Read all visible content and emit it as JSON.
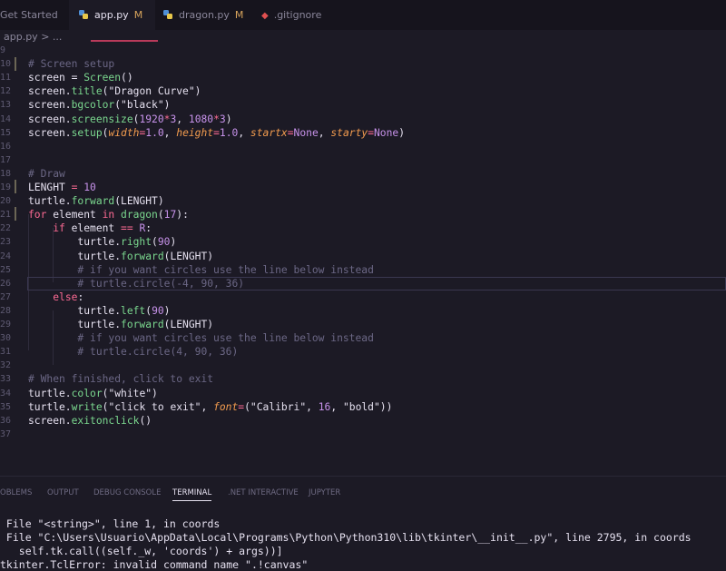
{
  "tabs": [
    {
      "label": "Get Started",
      "modified": "",
      "icon": "none"
    },
    {
      "label": "app.py",
      "modified": "M",
      "icon": "python-icon"
    },
    {
      "label": "dragon.py",
      "modified": "M",
      "icon": "python-icon"
    },
    {
      "label": ".gitignore",
      "modified": "",
      "icon": "git-icon"
    }
  ],
  "breadcrumb": "app.py > ...",
  "editor": {
    "lines": [
      {
        "n": "9",
        "html": ""
      },
      {
        "n": "10",
        "html": "<span class='c-com'># Screen setup</span>"
      },
      {
        "n": "11",
        "html": "screen = <span class='c-fn'>Screen</span>()"
      },
      {
        "n": "12",
        "html": "screen.<span class='c-fn'>title</span>(<span class='c-str'>\"Dragon Curve\"</span>)"
      },
      {
        "n": "13",
        "html": "screen.<span class='c-fn'>bgcolor</span>(<span class='c-str'>\"black\"</span>)"
      },
      {
        "n": "14",
        "html": "screen.<span class='c-fn'>screensize</span>(<span class='c-num'>1920</span><span class='c-op'>*</span><span class='c-num'>3</span>, <span class='c-num'>1080</span><span class='c-op'>*</span><span class='c-num'>3</span>)"
      },
      {
        "n": "15",
        "html": "screen.<span class='c-fn'>setup</span>(<span class='c-param'>width</span><span class='c-op'>=</span><span class='c-num'>1.0</span>, <span class='c-param'>height</span><span class='c-op'>=</span><span class='c-num'>1.0</span>, <span class='c-param'>startx</span><span class='c-op'>=</span><span class='c-const'>None</span>, <span class='c-param'>starty</span><span class='c-op'>=</span><span class='c-const'>None</span>)"
      },
      {
        "n": "16",
        "html": ""
      },
      {
        "n": "17",
        "html": ""
      },
      {
        "n": "18",
        "html": "<span class='c-com'># Draw</span>"
      },
      {
        "n": "19",
        "html": "LENGHT <span class='c-op'>=</span> <span class='c-num'>10</span>"
      },
      {
        "n": "20",
        "html": "turtle.<span class='c-fn'>forward</span>(LENGHT)"
      },
      {
        "n": "21",
        "html": "<span class='c-kw'>for</span> element <span class='c-kw'>in</span> <span class='c-fn'>dragon</span>(<span class='c-num'>17</span>):"
      },
      {
        "n": "22",
        "html": "    <span class='c-kw'>if</span> element <span class='c-op'>==</span> <span class='c-const'>R</span>:"
      },
      {
        "n": "23",
        "html": "        turtle.<span class='c-fn'>right</span>(<span class='c-num'>90</span>)"
      },
      {
        "n": "24",
        "html": "        turtle.<span class='c-fn'>forward</span>(LENGHT)"
      },
      {
        "n": "25",
        "html": "        <span class='c-com'># if you want circles use the line below instead</span>"
      },
      {
        "n": "26",
        "html": "        <span class='c-com'># turtle.circle(-4, 90, 36)</span>"
      },
      {
        "n": "27",
        "html": "    <span class='c-kw'>else</span>:"
      },
      {
        "n": "28",
        "html": "        turtle.<span class='c-fn'>left</span>(<span class='c-num'>90</span>)"
      },
      {
        "n": "29",
        "html": "        turtle.<span class='c-fn'>forward</span>(LENGHT)"
      },
      {
        "n": "30",
        "html": "        <span class='c-com'># if you want circles use the line below instead</span>"
      },
      {
        "n": "31",
        "html": "        <span class='c-com'># turtle.circle(4, 90, 36)</span>"
      },
      {
        "n": "32",
        "html": ""
      },
      {
        "n": "33",
        "html": "<span class='c-com'># When finished, click to exit</span>"
      },
      {
        "n": "34",
        "html": "turtle.<span class='c-fn'>color</span>(<span class='c-str'>\"white\"</span>)"
      },
      {
        "n": "35",
        "html": "turtle.<span class='c-fn'>write</span>(<span class='c-str'>\"click to exit\"</span>, <span class='c-param'>font</span><span class='c-op'>=</span>(<span class='c-str'>\"Calibri\"</span>, <span class='c-num'>16</span>, <span class='c-str'>\"bold\"</span>))"
      },
      {
        "n": "36",
        "html": "screen.<span class='c-fn'>exitonclick</span>()"
      },
      {
        "n": "37",
        "html": ""
      }
    ]
  },
  "panel": {
    "tabs": [
      "OBLEMS",
      "OUTPUT",
      "DEBUG CONSOLE",
      "TERMINAL",
      ".NET INTERACTIVE",
      "JUPYTER"
    ],
    "active": "TERMINAL"
  },
  "terminal": {
    "lines": [
      " File \"<string>\", line 1, in coords",
      " File \"C:\\Users\\Usuario\\AppData\\Local\\Programs\\Python\\Python310\\lib\\tkinter\\__init__.py\", line 2795, in coords",
      "   self.tk.call((self._w, 'coords') + args))]",
      "tkinter.TclError: invalid command name \".!canvas\""
    ]
  }
}
